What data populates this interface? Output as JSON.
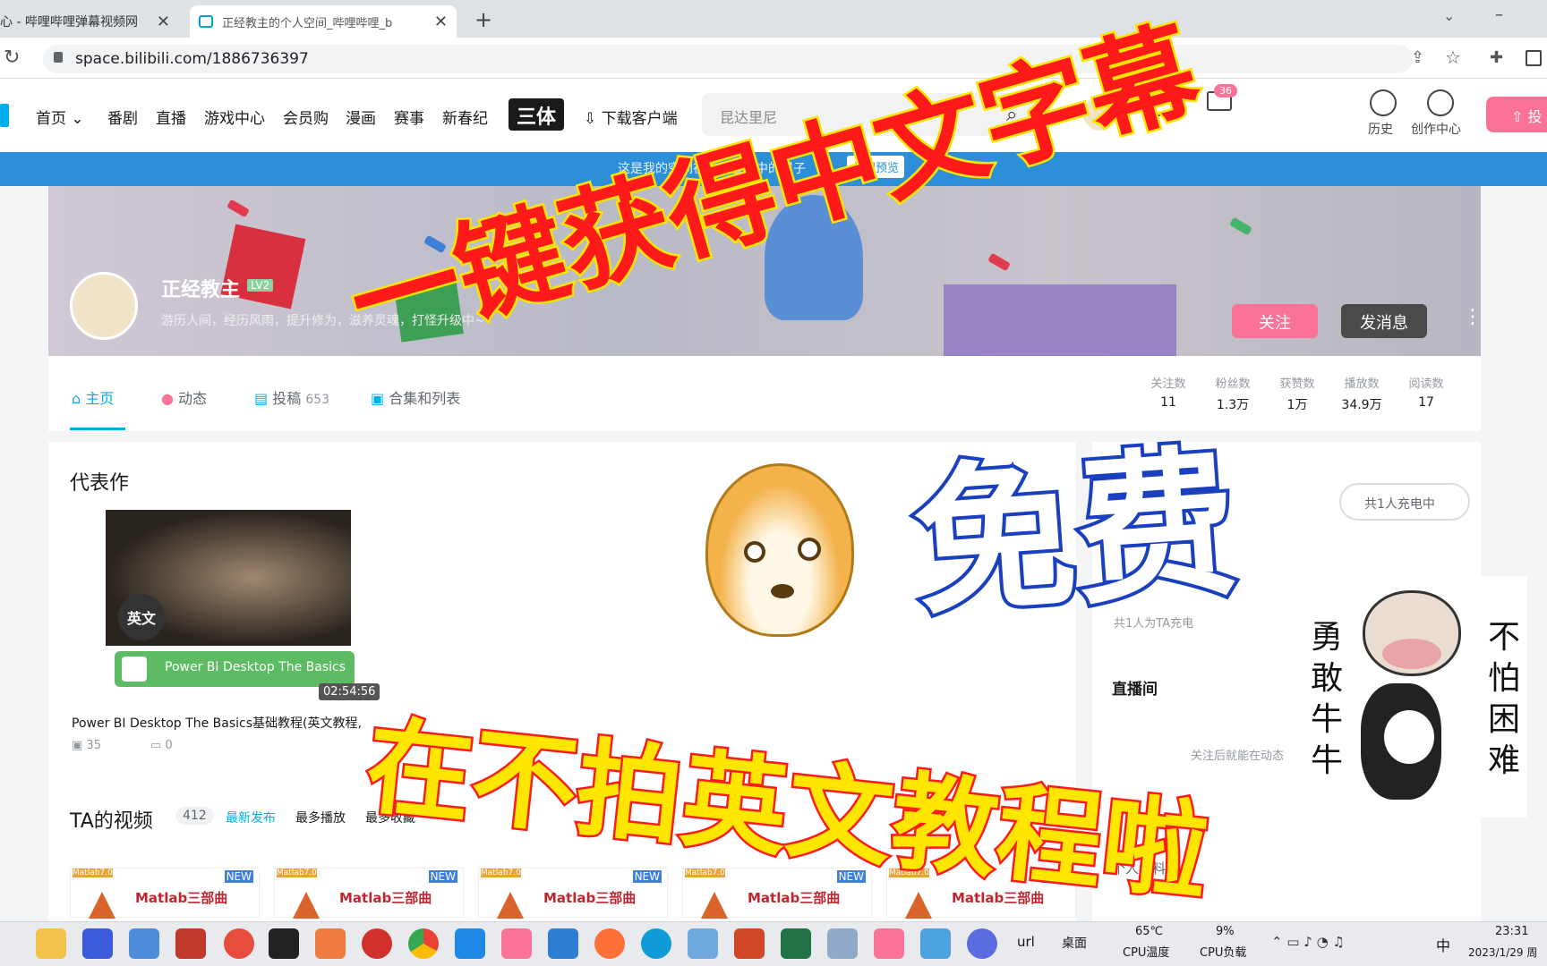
{
  "browser": {
    "tabs": [
      {
        "title": "心 - 哔哩哔哩弹幕视频网"
      },
      {
        "title": "正经教主的个人空间_哔哩哔哩_b"
      }
    ],
    "new_tab": "+",
    "url": "space.bilibili.com/1886736397"
  },
  "topnav": {
    "items": [
      "首页",
      "番剧",
      "直播",
      "游戏中心",
      "会员购",
      "漫画",
      "赛事",
      "新春纪"
    ],
    "logo_text": "三体",
    "download": "下载客户端",
    "search_placeholder": "昆达里尼",
    "badge": "36",
    "right_labels": [
      "历史",
      "创作中心"
    ],
    "upload": "投"
  },
  "notice": {
    "text": "这是我的空间在新访客眼中的样子",
    "close": "关闭预览"
  },
  "profile": {
    "name": "正经教主",
    "level": "LV2",
    "bio": "游历人间，经历风雨，提升修为，滋养灵魂，打怪升级中~",
    "follow": "关注",
    "message": "发消息"
  },
  "profile_tabs": [
    {
      "label": "主页"
    },
    {
      "label": "动态"
    },
    {
      "label": "投稿",
      "count": "653"
    },
    {
      "label": "合集和列表"
    }
  ],
  "stats": [
    {
      "label": "关注数",
      "value": "11"
    },
    {
      "label": "粉丝数",
      "value": "1.3万"
    },
    {
      "label": "获赞数",
      "value": "1万"
    },
    {
      "label": "播放数",
      "value": "34.9万"
    },
    {
      "label": "阅读数",
      "value": "17"
    }
  ],
  "featured": {
    "heading": "代表作",
    "badge": "英文",
    "pbi_label": "Power BI Desktop The Basics",
    "duration": "02:54:56",
    "title": "Power BI Desktop The Basics基础教程(英文教程,",
    "plays": "35",
    "comments": "0"
  },
  "videos": {
    "heading": "TA的视频",
    "count": "412",
    "sorts": [
      "最新发布",
      "最多播放",
      "最多收藏"
    ],
    "items": [
      {
        "tag": "Matlab7.0",
        "new": "NEW",
        "title": "Matlab三部曲"
      },
      {
        "tag": "Matlab7.0",
        "new": "NEW",
        "title": "Matlab三部曲"
      },
      {
        "tag": "Matlab7.0",
        "new": "NEW",
        "title": "Matlab三部曲"
      },
      {
        "tag": "Matlab7.0",
        "new": "NEW",
        "title": "Matlab三部曲"
      },
      {
        "tag": "Matlab7.0",
        "new": "NEW",
        "title": "Matlab三部曲"
      }
    ]
  },
  "sidebar": {
    "charging": "共1人充电中",
    "charged": "共1人为TA充电",
    "live": "直播间",
    "live_desc": "关注后就能在动态",
    "profile": "个人资料"
  },
  "overlay": {
    "headline": "一键获得中文字幕",
    "free": "免费",
    "bottom": "在不拍英文教程啦",
    "left_vertical": "勇敢牛牛",
    "right_vertical": "不怕困难"
  },
  "taskbar": {
    "url_label": "url",
    "desktop": "桌面",
    "temp": "65℃",
    "temp_label": "CPU温度",
    "load": "9%",
    "load_label": "CPU负载",
    "ime": "中",
    "time": "23:31",
    "date": "2023/1/29 周"
  },
  "colors": {
    "bili_pink": "#fb7299",
    "bili_blue": "#00aeec",
    "notice_blue": "#2c8fd8",
    "overlay_red": "#ff1a1a",
    "overlay_yellow": "#ffe600",
    "overlay_blue": "#1a3fbf"
  }
}
